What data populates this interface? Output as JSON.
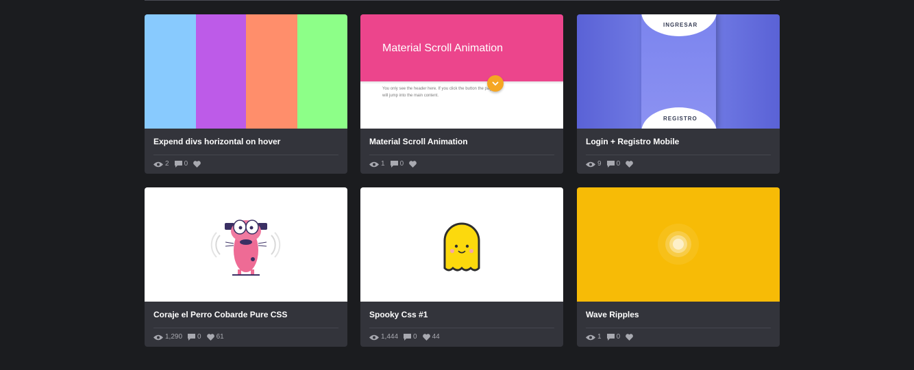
{
  "cards": [
    {
      "title": "Expend divs horizontal on hover",
      "views": "2",
      "comments": "0",
      "likes": ""
    },
    {
      "title": "Material Scroll Animation",
      "views": "1",
      "comments": "0",
      "likes": "",
      "preview": {
        "heading": "Material Scroll Animation",
        "body": "You only see the header here. If you click the button the page will jump into the main content."
      }
    },
    {
      "title": "Login + Registro Mobile",
      "views": "9",
      "comments": "0",
      "likes": "",
      "preview": {
        "top_label": "INGRESAR",
        "bottom_label": "REGISTRO"
      }
    },
    {
      "title": "Coraje el Perro Cobarde Pure CSS",
      "views": "1,290",
      "comments": "0",
      "likes": "61"
    },
    {
      "title": "Spooky Css #1",
      "views": "1,444",
      "comments": "0",
      "likes": "44"
    },
    {
      "title": "Wave Ripples",
      "views": "1",
      "comments": "0",
      "likes": ""
    }
  ],
  "stat_icons": [
    "eye-icon",
    "comment-icon",
    "heart-icon"
  ],
  "colors": {
    "page_bg": "#1b1c1f",
    "card_bg": "#33343b",
    "stripes": [
      "#88cafe",
      "#bd5be8",
      "#ff8e6b",
      "#8dff88"
    ],
    "material_pink": "#ec458c",
    "material_fab": "#f5a623",
    "login_blue": "#5a62d6",
    "ripple_yellow": "#f7bb06"
  }
}
